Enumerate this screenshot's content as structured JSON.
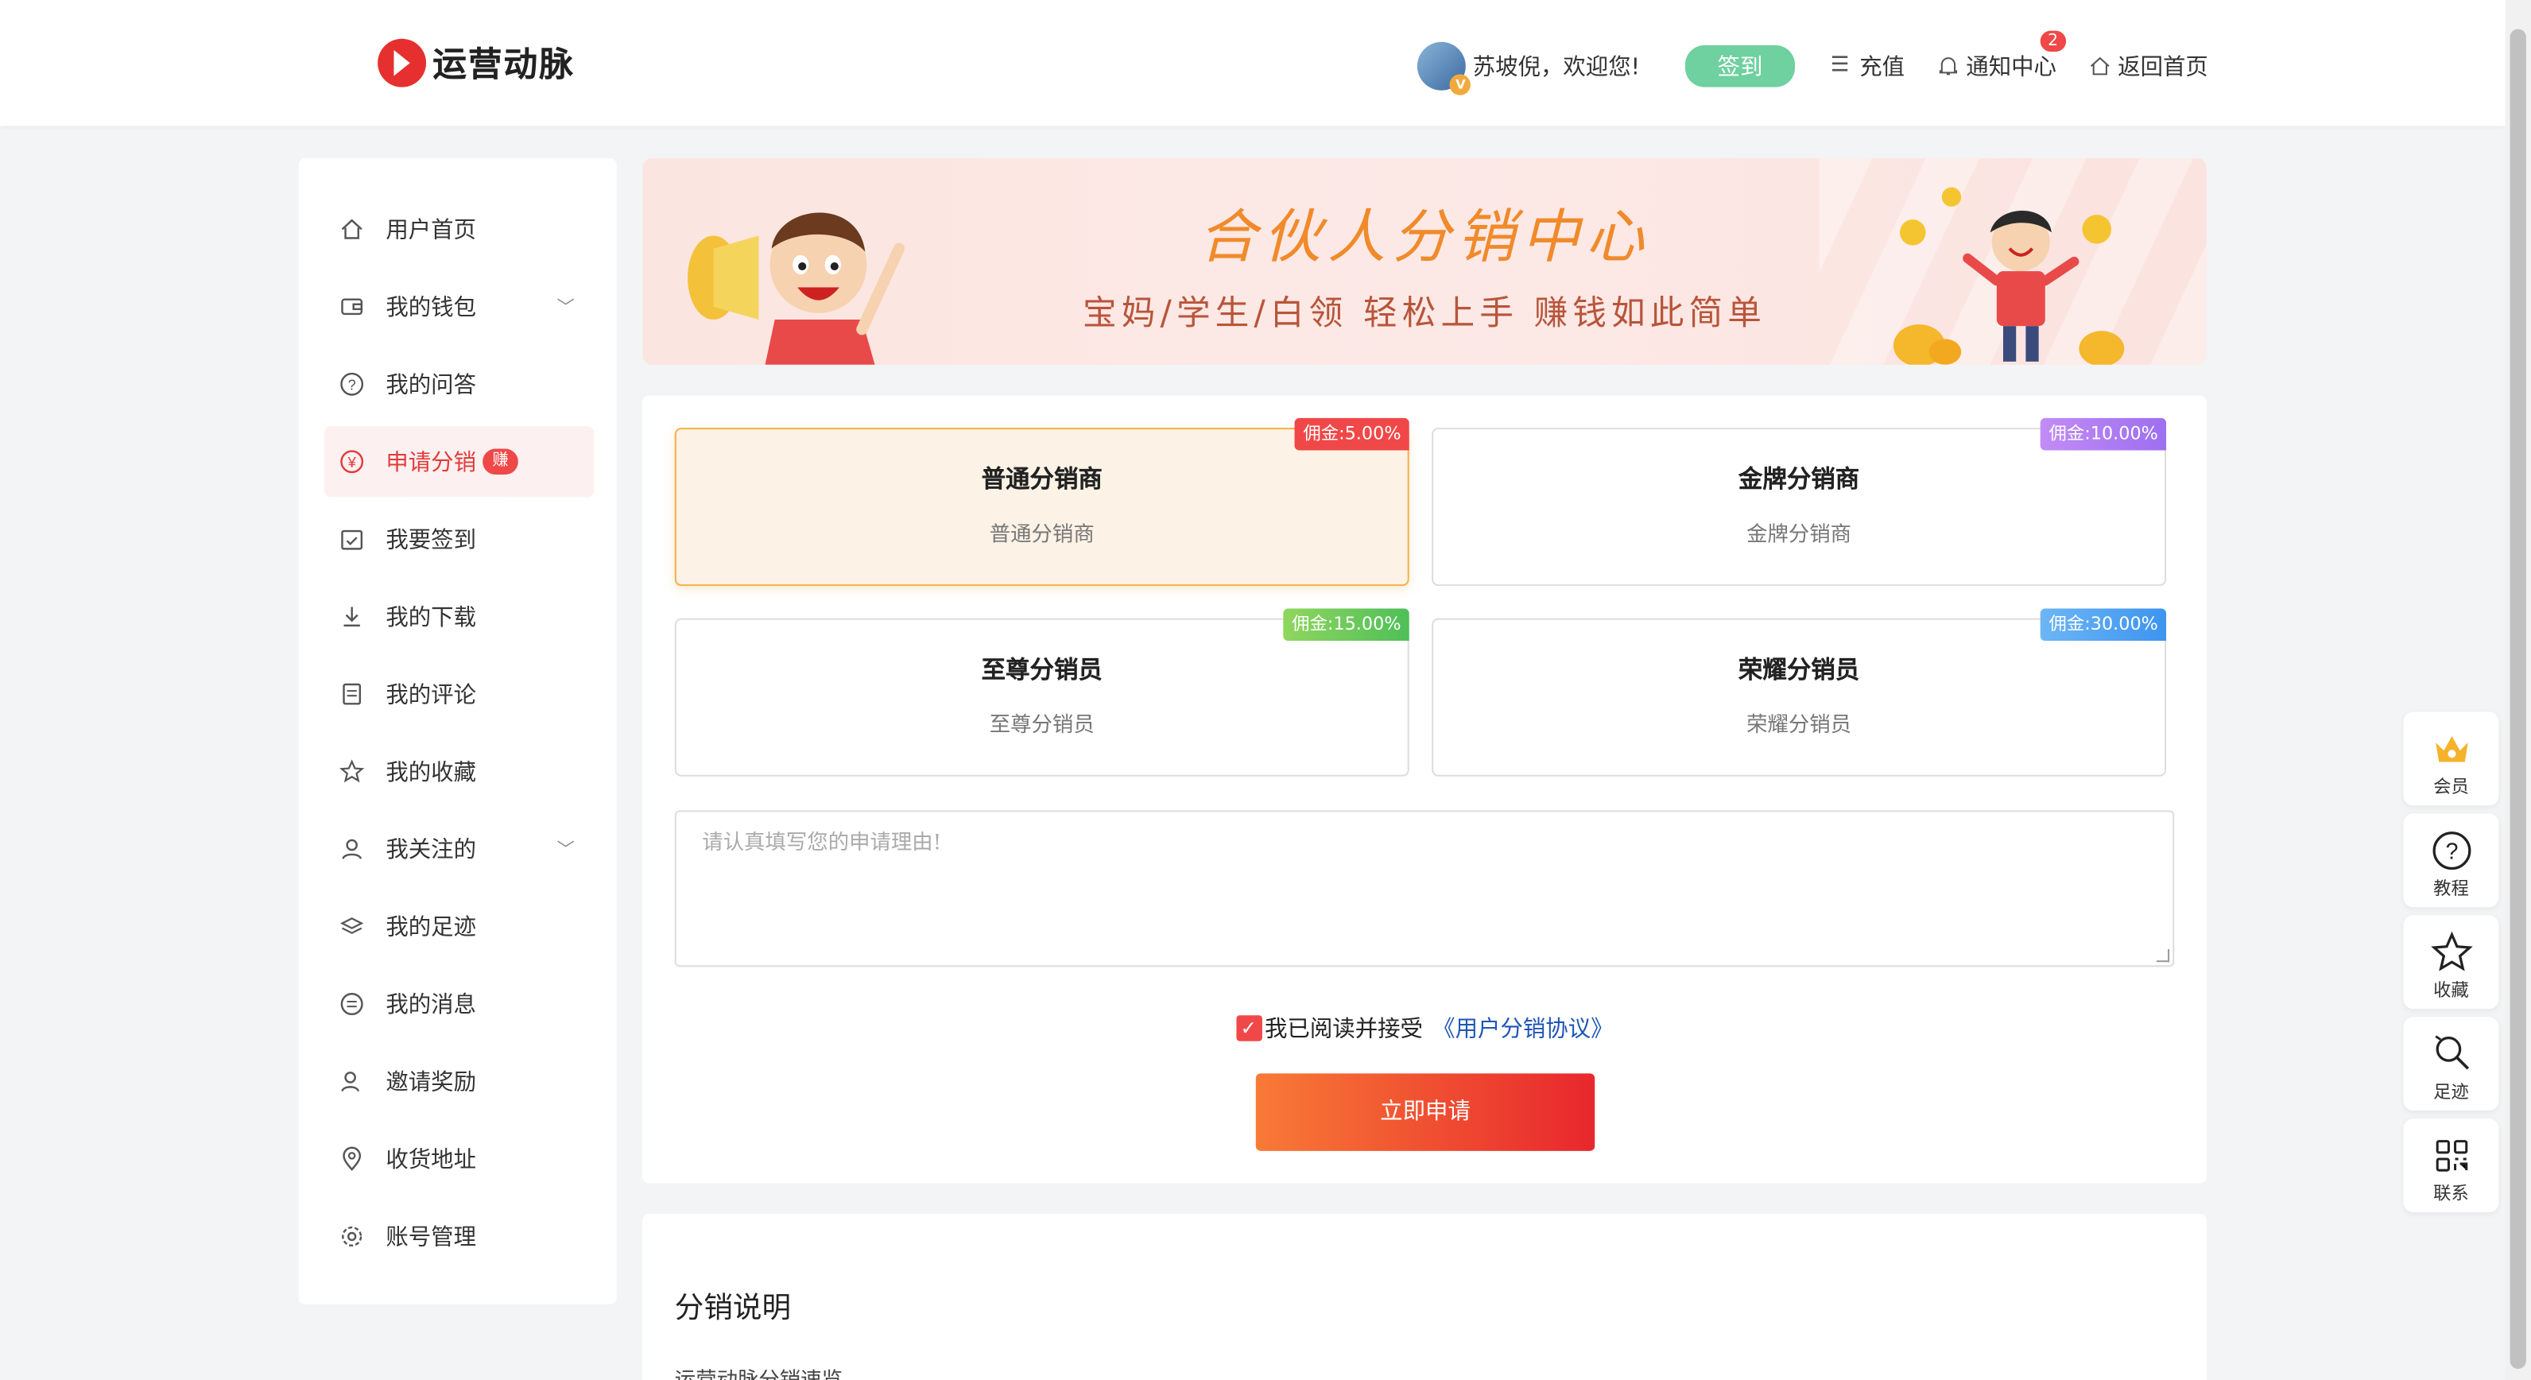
{
  "header": {
    "logo_text": "运营动脉",
    "welcome": "苏坡倪，欢迎您!",
    "avatar_badge": "V",
    "signin_label": "签到",
    "recharge_label": "充值",
    "notify_label": "通知中心",
    "notify_count": "2",
    "home_label": "返回首页"
  },
  "sidebar": {
    "items": [
      {
        "label": "用户首页",
        "icon": "home-icon"
      },
      {
        "label": "我的钱包",
        "icon": "wallet-icon"
      },
      {
        "label": "我的问答",
        "icon": "question-icon"
      },
      {
        "label": "申请分销",
        "icon": "yen-icon",
        "badge": "赚"
      },
      {
        "label": "我要签到",
        "icon": "calendar-check-icon"
      },
      {
        "label": "我的下载",
        "icon": "download-icon"
      },
      {
        "label": "我的评论",
        "icon": "comment-icon"
      },
      {
        "label": "我的收藏",
        "icon": "star-icon"
      },
      {
        "label": "我关注的",
        "icon": "user-icon"
      },
      {
        "label": "我的足迹",
        "icon": "layers-icon"
      },
      {
        "label": "我的消息",
        "icon": "message-icon"
      },
      {
        "label": "邀请奖励",
        "icon": "user-plus-icon"
      },
      {
        "label": "收货地址",
        "icon": "location-icon"
      },
      {
        "label": "账号管理",
        "icon": "gear-icon"
      }
    ]
  },
  "banner": {
    "title": "合伙人分销中心",
    "subtitle": "宝妈/学生/白领 轻松上手 赚钱如此简单"
  },
  "plans": [
    {
      "name": "普通分销商",
      "desc": "普通分销商",
      "tag": "佣金:5.00%",
      "color": "#f04848"
    },
    {
      "name": "金牌分销商",
      "desc": "金牌分销商",
      "tag": "佣金:10.00%",
      "color": "#b77cf0"
    },
    {
      "name": "至尊分销员",
      "desc": "至尊分销员",
      "tag": "佣金:15.00%",
      "color": "#5cc45c"
    },
    {
      "name": "荣耀分销员",
      "desc": "荣耀分销员",
      "tag": "佣金:30.00%",
      "color": "#4aa3f0"
    }
  ],
  "form": {
    "reason_placeholder": "请认真填写您的申请理由!",
    "agree_text": "我已阅读并接受",
    "agree_link": "《用户分销协议》",
    "apply_label": "立即申请"
  },
  "explain": {
    "title": "分销说明",
    "subtitle": "运营动脉分销速览"
  },
  "float_bar": [
    {
      "label": "会员",
      "icon": "crown-icon"
    },
    {
      "label": "教程",
      "icon": "question-circle-icon"
    },
    {
      "label": "收藏",
      "icon": "star-icon"
    },
    {
      "label": "足迹",
      "icon": "footprint-icon"
    },
    {
      "label": "联系",
      "icon": "qrcode-icon"
    }
  ]
}
